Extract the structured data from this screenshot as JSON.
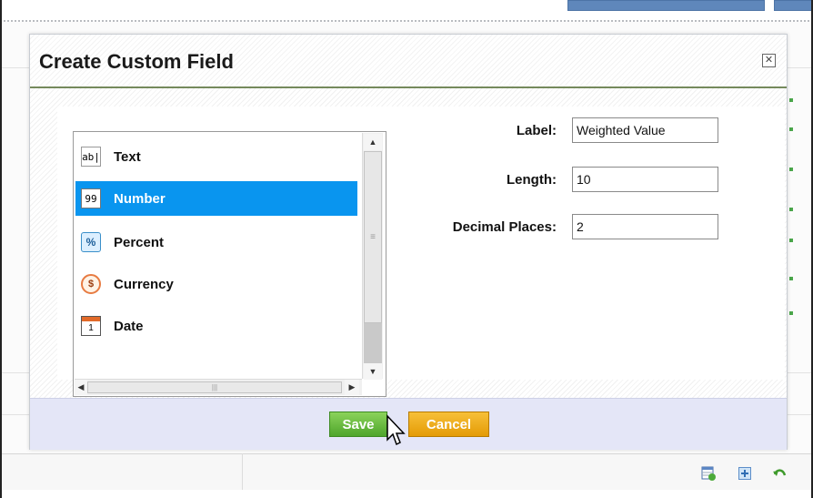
{
  "dialog": {
    "title": "Create Custom Field",
    "close_symbol": "✕"
  },
  "field_types": [
    {
      "label": "Text",
      "icon": "text-field-icon",
      "glyph": "ab|",
      "selected": false
    },
    {
      "label": "Number",
      "icon": "number-field-icon",
      "glyph": "99",
      "selected": true
    },
    {
      "label": "Percent",
      "icon": "percent-field-icon",
      "glyph": "%",
      "selected": false
    },
    {
      "label": "Currency",
      "icon": "currency-field-icon",
      "glyph": "$",
      "selected": false
    },
    {
      "label": "Date",
      "icon": "date-field-icon",
      "glyph": "1",
      "selected": false
    }
  ],
  "form": {
    "label": {
      "label": "Label:",
      "value": "Weighted Value"
    },
    "length": {
      "label": "Length:",
      "value": "10"
    },
    "decimal_places": {
      "label": "Decimal Places:",
      "value": "2"
    }
  },
  "buttons": {
    "save": "Save",
    "cancel": "Cancel"
  },
  "colors": {
    "selection": "#0995ef",
    "save": "#5cb535",
    "cancel": "#eea816",
    "header_rule": "#758a5c",
    "footer_bg": "#e4e6f7"
  }
}
